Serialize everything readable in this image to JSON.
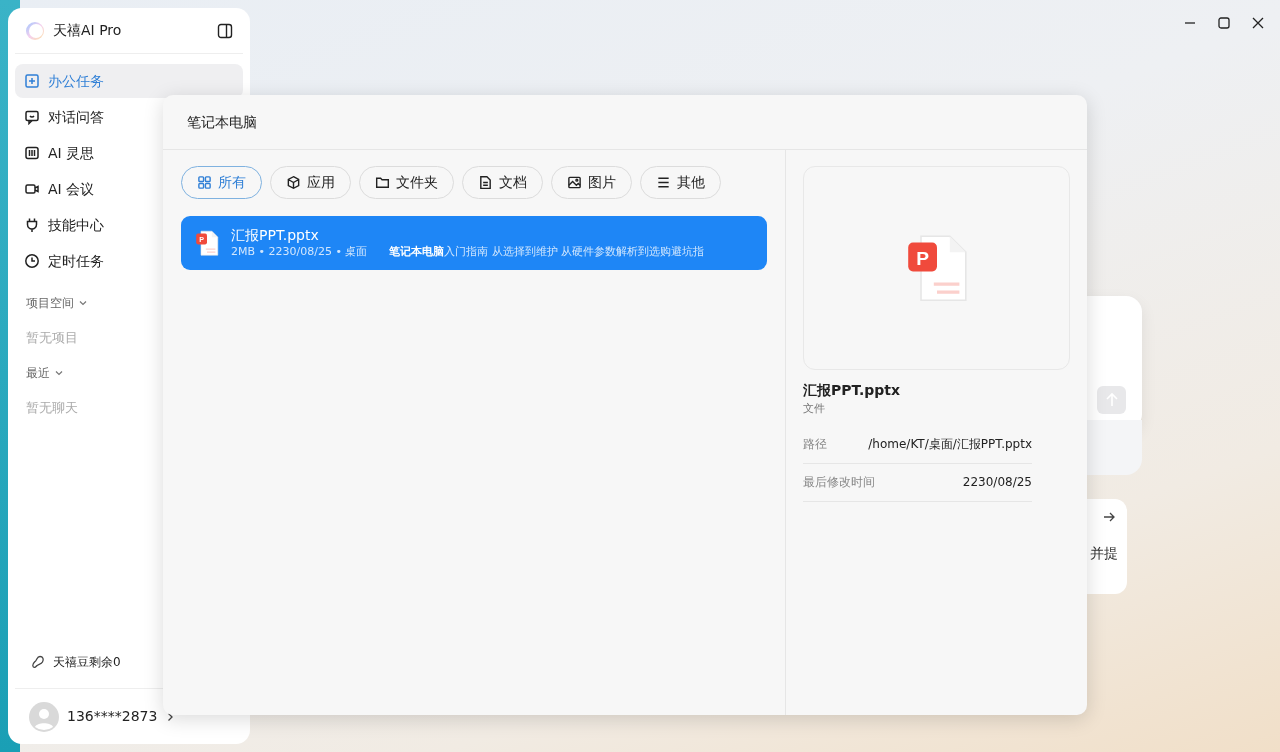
{
  "app": {
    "title": "天禧AI Pro"
  },
  "nav": [
    {
      "label": "办公任务",
      "selected": true
    },
    {
      "label": "对话问答",
      "selected": false
    },
    {
      "label": "AI 灵思",
      "selected": false
    },
    {
      "label": "AI 会议",
      "selected": false
    },
    {
      "label": "技能中心",
      "selected": false
    },
    {
      "label": "定时任务",
      "selected": false
    }
  ],
  "sections": [
    {
      "title": "项目空间",
      "expanded": true,
      "empty_text": "暂无项目"
    },
    {
      "title": "最近",
      "expanded": true,
      "empty_text": "暂无聊天"
    }
  ],
  "credits": "天禧豆剩余0",
  "user": {
    "phone": "136****2873"
  },
  "search": {
    "value": "笔记本电脑"
  },
  "filters": [
    {
      "label": "所有",
      "selected": true
    },
    {
      "label": "应用",
      "selected": false
    },
    {
      "label": "文件夹",
      "selected": false
    },
    {
      "label": "文档",
      "selected": false
    },
    {
      "label": "图片",
      "selected": false
    },
    {
      "label": "其他",
      "selected": false
    }
  ],
  "results": [
    {
      "name": "汇报PPT.pptx",
      "meta": "2MB • 2230/08/25 • 桌面",
      "snippet": "**笔记本电脑**入门指南 从选择到维护 从硬件参数解析到选购避坑指",
      "icon_letter": "P",
      "selected": true
    }
  ],
  "preview": {
    "name": "汇报PPT.pptx",
    "type": "文件",
    "icon_letter": "P",
    "details": [
      {
        "label": "路径",
        "value": "/home/KT/桌面/汇报PPT.pptx"
      },
      {
        "label": "最后修改时间",
        "value": "2230/08/25"
      }
    ]
  },
  "background": {
    "card_text": "并提"
  }
}
